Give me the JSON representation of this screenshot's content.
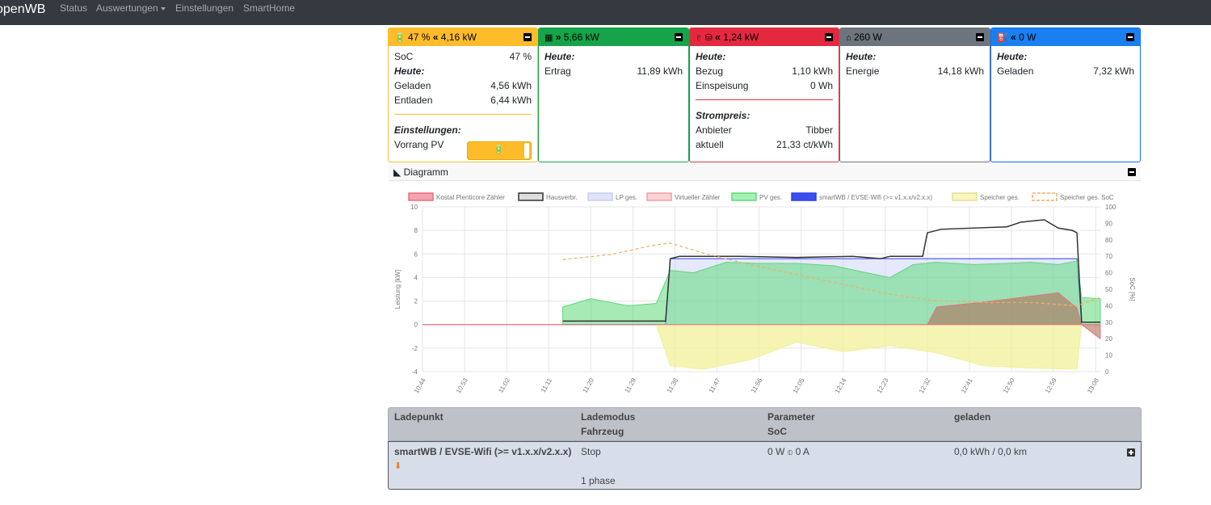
{
  "nav": {
    "brand": "openWB",
    "items": [
      "Status",
      "Auswertungen",
      "Einstellungen",
      "SmartHome"
    ]
  },
  "colors": {
    "battery": "#febc2b",
    "pv": "#16a34a",
    "grid": "#dc3545",
    "house": "#6c757d",
    "chargepoint": "#0d6efd"
  },
  "cards": {
    "battery": {
      "icon": "battery-car-icon",
      "head_soc": "47 %",
      "head_power": "4,16 kW",
      "soc_label": "SoC",
      "soc_value": "47 %",
      "today": "Heute:",
      "charged_label": "Geladen",
      "charged_value": "4,56 kWh",
      "discharged_label": "Entladen",
      "discharged_value": "6,44 kWh",
      "settings": "Einstellungen:",
      "priority_label": "Vorrang PV"
    },
    "pv": {
      "icon": "solar-panel-icon",
      "head_power": "5,66 kW",
      "today": "Heute:",
      "yield_label": "Ertrag",
      "yield_value": "11,89 kWh"
    },
    "grid": {
      "icon": "power-tower-icon",
      "head_power": "1,24 kW",
      "today": "Heute:",
      "import_label": "Bezug",
      "import_value": "1,10 kWh",
      "export_label": "Einspeisung",
      "export_value": "0 Wh",
      "price_title": "Strompreis:",
      "provider_label": "Anbieter",
      "provider_value": "Tibber",
      "current_label": "aktuell",
      "current_value": "21,33 ct/kWh"
    },
    "house": {
      "icon": "home-icon",
      "head_power": "260 W",
      "today": "Heute:",
      "energy_label": "Energie",
      "energy_value": "14,18 kWh"
    },
    "chargepoint": {
      "icon": "charging-station-icon",
      "head_power": "0 W",
      "today": "Heute:",
      "charged_label": "Geladen",
      "charged_value": "7,32 kWh"
    }
  },
  "diagram": {
    "title": "Diagramm"
  },
  "chart_data": {
    "type": "area",
    "legend": [
      "Kostal Plenticore Zähler",
      "Hausverbr.",
      "LP ges.",
      "Virtueller Zähler",
      "PV ges.",
      "smartWB / EVSE-Wifi (>= v1.x.x/v2.x.x)",
      "Speicher ges.",
      "Speicher ges. SoC"
    ],
    "legend_position": "top",
    "ylabel": "Leistung [kW]",
    "y2label": "SoC [%]",
    "ylim": [
      -4,
      10
    ],
    "y_ticks": [
      "10",
      "8",
      "6",
      "4",
      "2",
      "0",
      "-2",
      "-4"
    ],
    "y2lim": [
      0,
      100
    ],
    "y2_ticks": [
      "100",
      "90",
      "80",
      "70",
      "60",
      "50",
      "40",
      "30",
      "20",
      "10",
      "0"
    ],
    "x_ticks": [
      "10:44",
      "10:53",
      "11:02",
      "11:11",
      "11:20",
      "11:29",
      "11:38",
      "11:47",
      "11:56",
      "12:05",
      "12:14",
      "12:23",
      "12:32",
      "12:41",
      "12:50",
      "12:59",
      "13:08"
    ],
    "xlim_minutes": [
      0,
      145
    ],
    "series": [
      {
        "name": "Hausverbr.",
        "color": "#333333",
        "points": [
          [
            30,
            0.3
          ],
          [
            52,
            0.3
          ],
          [
            53,
            5.6
          ],
          [
            55,
            5.8
          ],
          [
            68,
            5.8
          ],
          [
            80,
            5.7
          ],
          [
            92,
            5.8
          ],
          [
            98,
            5.6
          ],
          [
            100,
            5.8
          ],
          [
            107,
            5.8
          ],
          [
            108,
            7.8
          ],
          [
            111,
            8.1
          ],
          [
            125,
            8.3
          ],
          [
            128,
            8.7
          ],
          [
            133,
            8.9
          ],
          [
            136,
            8.2
          ],
          [
            139,
            8.0
          ],
          [
            140,
            7.8
          ],
          [
            141,
            0.2
          ],
          [
            145,
            0.2
          ]
        ]
      },
      {
        "name": "smartWB / EVSE-Wifi (>= v1.x.x/v2.x.x)",
        "color": "#2f3fe6",
        "points": [
          [
            30,
            0
          ],
          [
            52,
            0
          ],
          [
            53,
            5.6
          ],
          [
            140,
            5.6
          ],
          [
            141,
            0
          ],
          [
            145,
            0
          ]
        ]
      },
      {
        "name": "PV ges.",
        "color": "#5fd87a",
        "points": [
          [
            30,
            1.5
          ],
          [
            36,
            2.2
          ],
          [
            44,
            1.6
          ],
          [
            50,
            1.8
          ],
          [
            53,
            4.6
          ],
          [
            58,
            4.4
          ],
          [
            65,
            5.3
          ],
          [
            72,
            5.2
          ],
          [
            80,
            5.2
          ],
          [
            88,
            5.0
          ],
          [
            95,
            4.4
          ],
          [
            100,
            4.0
          ],
          [
            105,
            5.1
          ],
          [
            110,
            5.3
          ],
          [
            118,
            5.1
          ],
          [
            125,
            5.2
          ],
          [
            130,
            5.3
          ],
          [
            136,
            5.1
          ],
          [
            140,
            5.4
          ],
          [
            141,
            2.3
          ],
          [
            145,
            2.2
          ]
        ]
      },
      {
        "name": "Speicher ges.",
        "color": "#f2f09a",
        "points": [
          [
            50,
            0
          ],
          [
            53,
            -3.5
          ],
          [
            60,
            -3.8
          ],
          [
            70,
            -3.0
          ],
          [
            80,
            -1.5
          ],
          [
            90,
            -2.3
          ],
          [
            100,
            -1.8
          ],
          [
            110,
            -2.4
          ],
          [
            120,
            -3.5
          ],
          [
            130,
            -3.7
          ],
          [
            140,
            -3.8
          ],
          [
            141,
            0
          ],
          [
            145,
            0
          ]
        ]
      },
      {
        "name": "Kostal Plenticore Zähler",
        "color": "#e8707f",
        "points": [
          [
            0,
            0
          ],
          [
            108,
            0
          ],
          [
            110,
            1.5
          ],
          [
            120,
            1.9
          ],
          [
            128,
            2.3
          ],
          [
            136,
            2.7
          ],
          [
            140,
            1.4
          ],
          [
            141,
            0
          ],
          [
            145,
            -1.2
          ]
        ]
      },
      {
        "name": "Speicher ges. SoC",
        "color": "#f0b060",
        "points": [
          [
            30,
            68
          ],
          [
            40,
            71
          ],
          [
            50,
            77
          ],
          [
            53,
            78
          ],
          [
            60,
            72
          ],
          [
            70,
            65
          ],
          [
            80,
            59
          ],
          [
            90,
            53
          ],
          [
            100,
            47
          ],
          [
            110,
            43
          ],
          [
            120,
            42
          ],
          [
            130,
            42
          ],
          [
            140,
            40
          ],
          [
            145,
            45
          ]
        ]
      }
    ]
  },
  "chargepoints": {
    "headers": {
      "lp": "Ladepunkt",
      "mode": "Lademodus",
      "vehicle": "Fahrzeug",
      "params": "Parameter",
      "soc": "SoC",
      "charged": "geladen"
    },
    "rows": [
      {
        "name": "smartWB / EVSE-Wifi (>= v1.x.x/v2.x.x)",
        "mode": "Stop",
        "params": "0 W",
        "current": "0 A",
        "charged": "0,0 kWh / 0,0 km",
        "phases": "1 phase"
      }
    ]
  }
}
